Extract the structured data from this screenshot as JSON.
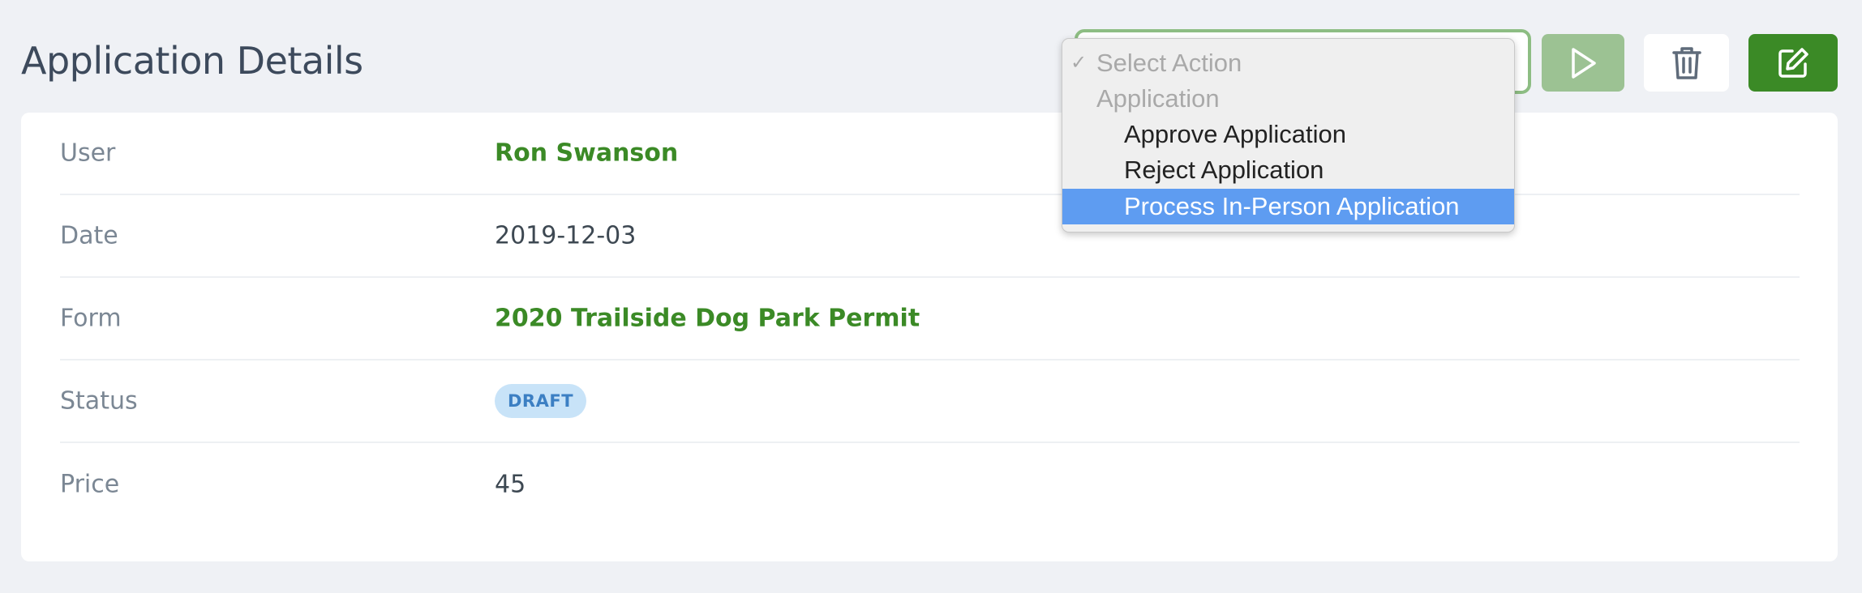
{
  "header": {
    "title": "Application Details"
  },
  "toolbar": {
    "action_select": {
      "value": "Select Action",
      "check_glyph": "✓",
      "options": [
        {
          "label": "Select Action",
          "kind": "placeholder",
          "checked": true
        },
        {
          "label": "Application",
          "kind": "group"
        },
        {
          "label": "Approve Application",
          "kind": "option"
        },
        {
          "label": "Reject Application",
          "kind": "option"
        },
        {
          "label": "Process In-Person Application",
          "kind": "option",
          "highlighted": true
        }
      ]
    },
    "run_icon": "play-icon",
    "delete_icon": "trash-icon",
    "edit_icon": "edit-icon"
  },
  "details": {
    "user": {
      "label": "User",
      "value": "Ron Swanson"
    },
    "date": {
      "label": "Date",
      "value": "2019-12-03"
    },
    "form": {
      "label": "Form",
      "value": "2020 Trailside Dog Park Permit"
    },
    "status": {
      "label": "Status",
      "value": "DRAFT"
    },
    "price": {
      "label": "Price",
      "value": "45"
    }
  },
  "colors": {
    "accent": "#3b8a26",
    "accent_muted": "#9cc293",
    "badge_bg": "#c8e3f8",
    "badge_text": "#3c7fc3",
    "dropdown_highlight": "#5e9cf1",
    "page_bg": "#eff1f5"
  }
}
